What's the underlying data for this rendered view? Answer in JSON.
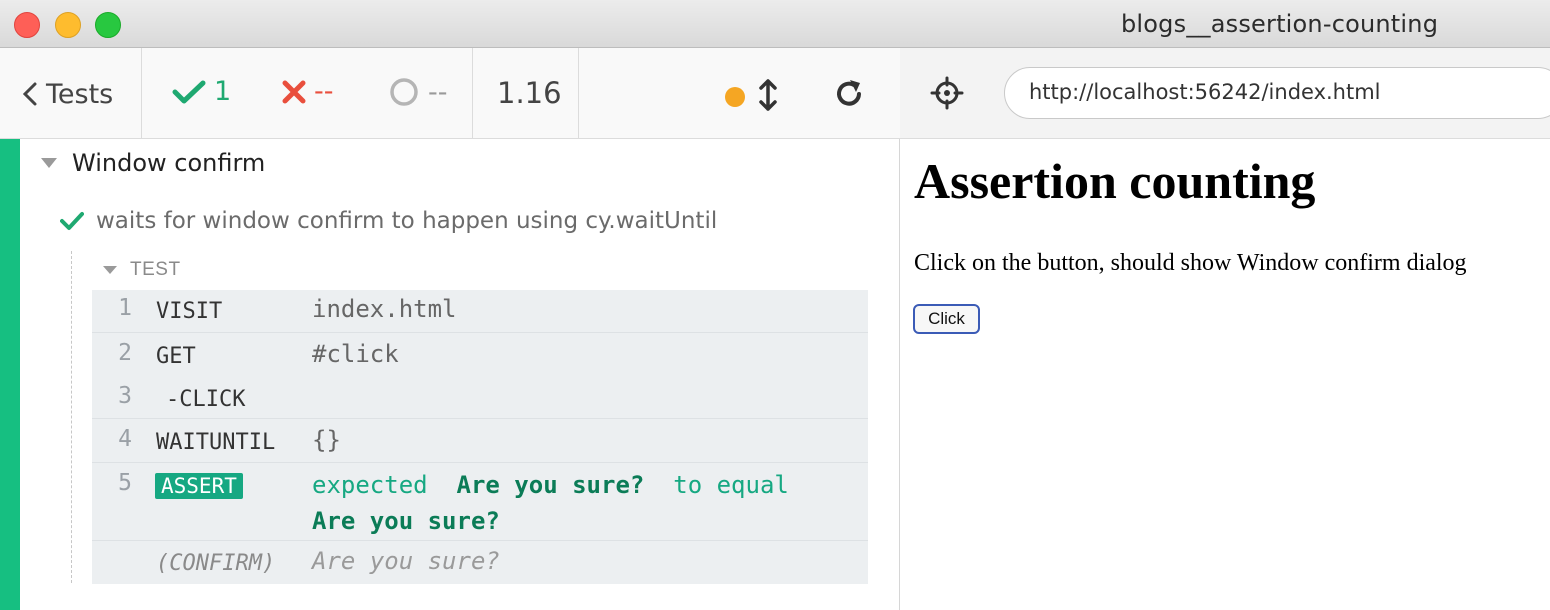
{
  "window": {
    "title": "blogs__assertion-counting"
  },
  "reporter": {
    "tests_label": "Tests",
    "passed": "1",
    "failed": "--",
    "pending": "--",
    "duration": "1.16",
    "status_color": "#f5a623",
    "suite": {
      "title": "Window confirm"
    },
    "test": {
      "title": "waits for window confirm to happen using cy.waitUntil",
      "section_label": "TEST",
      "commands": [
        {
          "num": "1",
          "name": "VISIT",
          "message": "index.html"
        },
        {
          "num": "2",
          "name": "GET",
          "message": "#click"
        },
        {
          "num": "3",
          "name": "-CLICK",
          "message": ""
        },
        {
          "num": "4",
          "name": "WAITUNTIL",
          "message": "{}"
        },
        {
          "num": "5",
          "name": "ASSERT",
          "parts": [
            "expected",
            "Are you sure?",
            "to equal",
            "Are you sure?"
          ]
        },
        {
          "num": "",
          "name": "(CONFIRM)",
          "message": "Are you sure?"
        }
      ]
    }
  },
  "aut": {
    "url": "http://localhost:56242/index.html",
    "heading": "Assertion counting",
    "paragraph": "Click on the button, should show Window confirm dialog",
    "button_label": "Click"
  }
}
